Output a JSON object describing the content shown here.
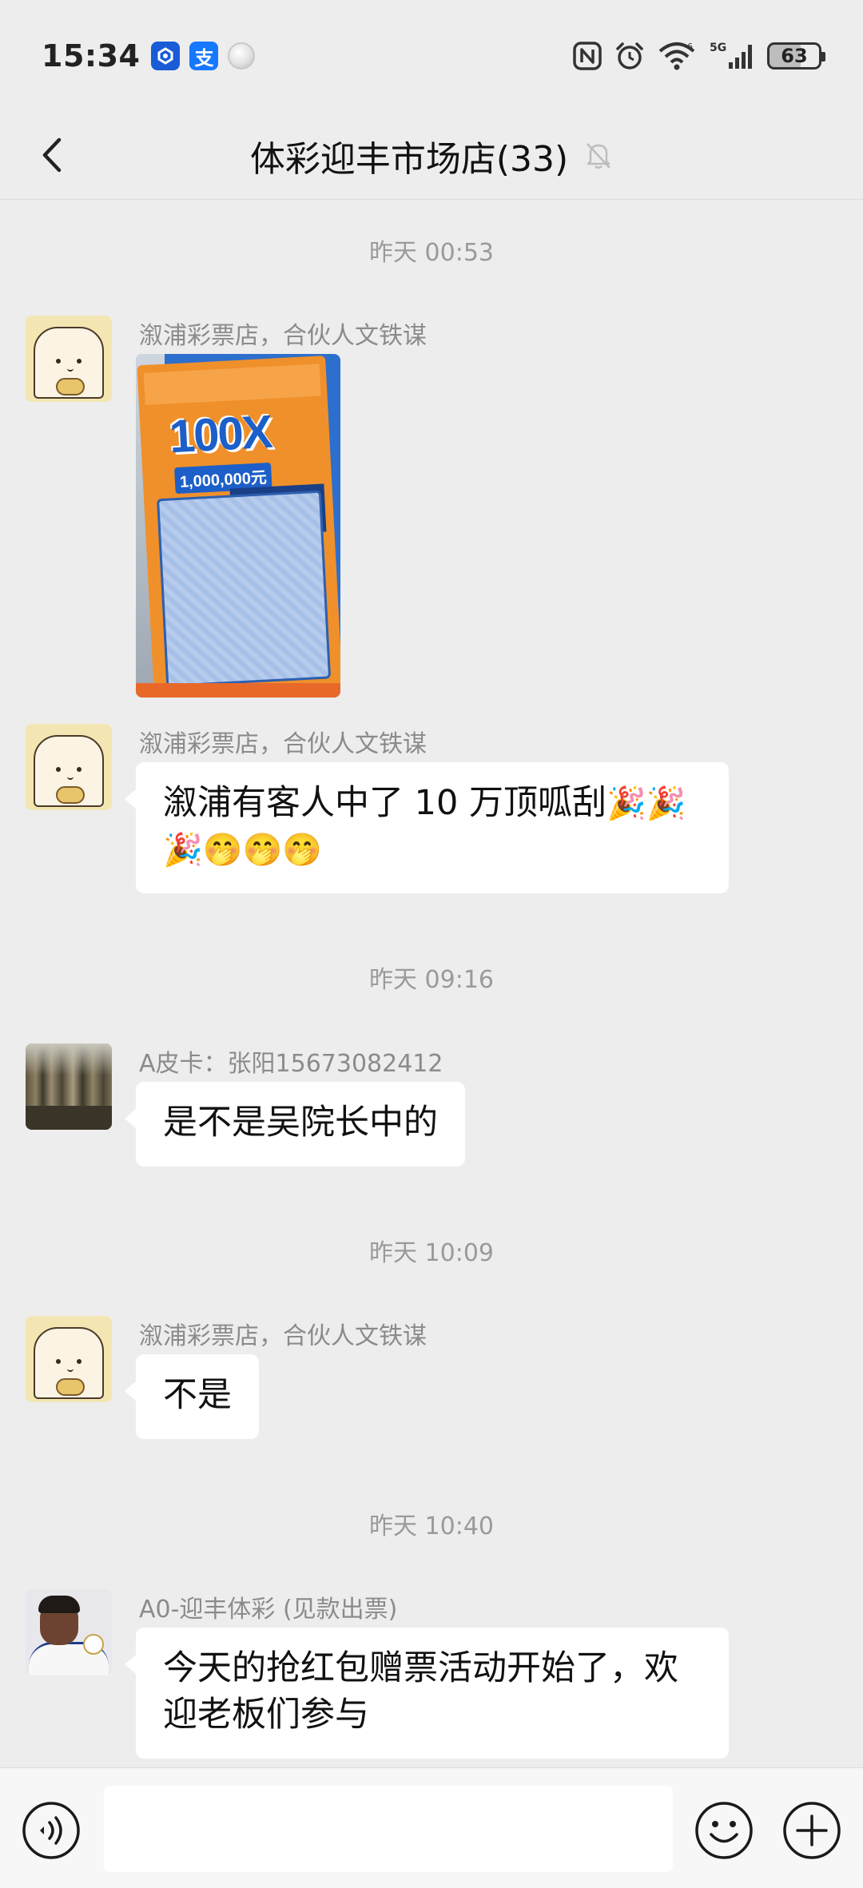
{
  "status_bar": {
    "time": "15:34",
    "alipay_glyph": "支",
    "network": "5G",
    "battery": "63",
    "icons": [
      "c-app-icon",
      "alipay-icon",
      "moon-app-icon",
      "nfc-icon",
      "alarm-icon",
      "wifi-icon",
      "signal-icon",
      "battery-icon"
    ]
  },
  "header": {
    "title": "体彩迎丰市场店(33)",
    "back_icon": "chevron-left-icon",
    "mute_icon": "bell-muted-icon"
  },
  "messages": [
    {
      "type": "timestamp",
      "text": "昨天 00:53"
    },
    {
      "type": "image",
      "sender": "溆浦彩票店，合伙人文铁谋",
      "avatar": "bread-cartoon",
      "image": {
        "headline": "100X",
        "prize": "1,000,000元",
        "description": "scratch lottery ticket photo"
      }
    },
    {
      "type": "text",
      "sender": "溆浦彩票店，合伙人文铁谋",
      "avatar": "bread-cartoon",
      "line1": "溆浦有客人中了 10 万顶呱刮",
      "line1_emoji": "🎉🎉",
      "line2": "🎉🤭🤭🤭"
    },
    {
      "type": "timestamp",
      "text": "昨天 09:16"
    },
    {
      "type": "text",
      "sender": "A皮卡：张阳15673082412",
      "avatar": "forest-photo",
      "text": "是不是吴院长中的"
    },
    {
      "type": "timestamp",
      "text": "昨天 10:09"
    },
    {
      "type": "text",
      "sender": "溆浦彩票店，合伙人文铁谋",
      "avatar": "bread-cartoon",
      "text": "不是"
    },
    {
      "type": "timestamp",
      "text": "昨天 10:40"
    },
    {
      "type": "text",
      "sender": "A0-迎丰体彩 (见款出票)",
      "avatar": "player-photo",
      "line1": "今天的抢红包赠票活动开始了，欢",
      "line2": "迎老板们参与"
    }
  ],
  "input_bar": {
    "placeholder": "",
    "value": "",
    "voice_icon": "voice-icon",
    "emoji_icon": "emoji-icon",
    "plus_icon": "plus-icon"
  },
  "colors": {
    "background": "#ededed",
    "bubble": "#ffffff",
    "timestamp_text": "#9a9a9a",
    "sender_text": "#8b8b8b",
    "input_bar": "#f7f7f7"
  }
}
